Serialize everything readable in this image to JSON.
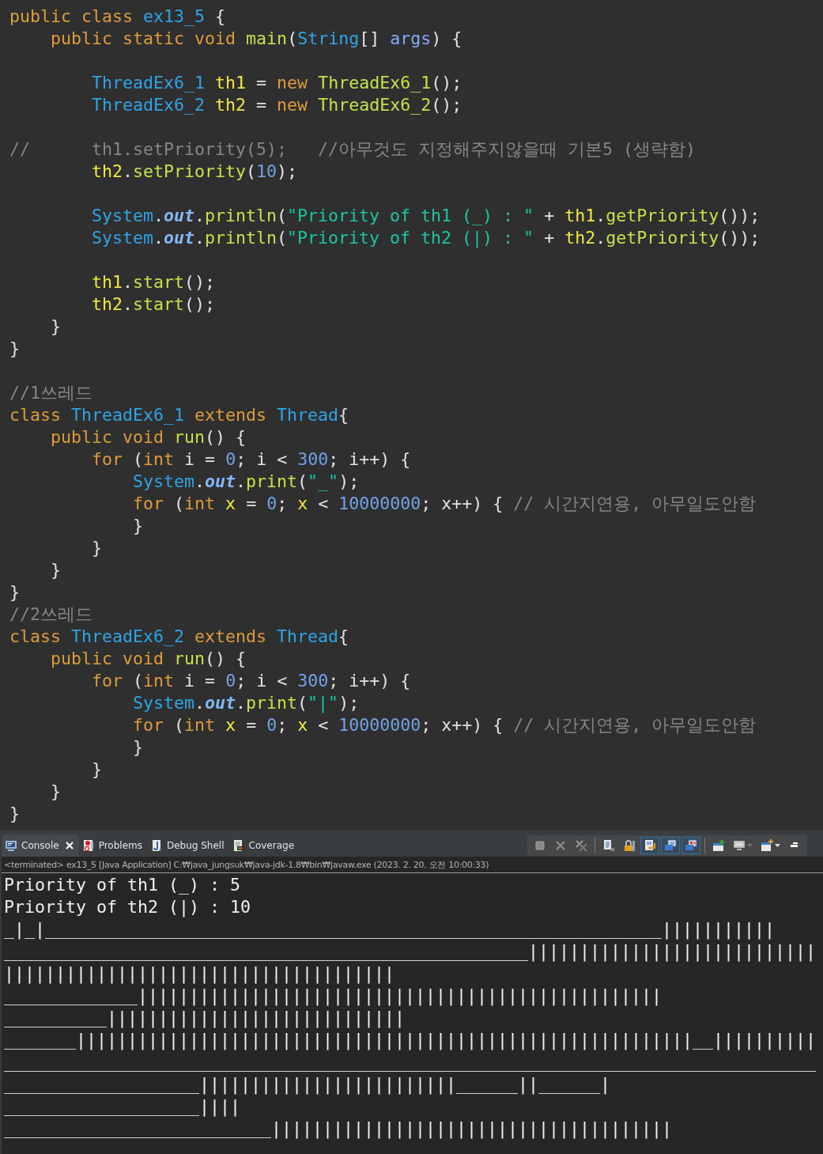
{
  "editor": {
    "lines": [
      {
        "kind": "code",
        "tokens": [
          {
            "kind": "keyword",
            "text": "public"
          },
          {
            "kind": "keyword",
            "text": " class"
          },
          {
            "kind": "type",
            "text": " ex13_5"
          },
          {
            "kind": "plain",
            "text": " {"
          }
        ]
      },
      {
        "kind": "code",
        "tokens": [
          {
            "kind": "keyword",
            "text": "    public"
          },
          {
            "kind": "keyword",
            "text": " static"
          },
          {
            "kind": "keyword",
            "text": " void"
          },
          {
            "kind": "method",
            "text": " main"
          },
          {
            "kind": "plain",
            "text": "("
          },
          {
            "kind": "type",
            "text": "String"
          },
          {
            "kind": "plain",
            "text": "[]"
          },
          {
            "kind": "parameter",
            "text": " args"
          },
          {
            "kind": "plain",
            "text": ") {"
          }
        ]
      },
      {
        "kind": "blank"
      },
      {
        "kind": "code",
        "tokens": [
          {
            "kind": "type",
            "text": "        ThreadEx6_1"
          },
          {
            "kind": "variable",
            "text": " th1"
          },
          {
            "kind": "plain",
            "text": " ="
          },
          {
            "kind": "keyword",
            "text": " new"
          },
          {
            "kind": "method",
            "text": " ThreadEx6_1"
          },
          {
            "kind": "plain",
            "text": "();"
          }
        ]
      },
      {
        "kind": "code",
        "tokens": [
          {
            "kind": "type",
            "text": "        ThreadEx6_2"
          },
          {
            "kind": "variable",
            "text": " th2"
          },
          {
            "kind": "plain",
            "text": " ="
          },
          {
            "kind": "keyword",
            "text": " new"
          },
          {
            "kind": "method",
            "text": " ThreadEx6_2"
          },
          {
            "kind": "plain",
            "text": "();"
          }
        ]
      },
      {
        "kind": "blank"
      },
      {
        "kind": "code",
        "tokens": [
          {
            "kind": "comment",
            "text": "//      th1.setPriority(5);   //아무것도 지정해주지않을때 기본5 (생략함)"
          }
        ]
      },
      {
        "kind": "code",
        "tokens": [
          {
            "kind": "variable",
            "text": "        th2"
          },
          {
            "kind": "plain",
            "text": "."
          },
          {
            "kind": "method",
            "text": "setPriority"
          },
          {
            "kind": "plain",
            "text": "("
          },
          {
            "kind": "number",
            "text": "10"
          },
          {
            "kind": "plain",
            "text": ");"
          }
        ]
      },
      {
        "kind": "blank"
      },
      {
        "kind": "code",
        "tokens": [
          {
            "kind": "type",
            "text": "        System"
          },
          {
            "kind": "plain",
            "text": "."
          },
          {
            "kind": "field",
            "text": "out"
          },
          {
            "kind": "plain",
            "text": "."
          },
          {
            "kind": "method",
            "text": "println"
          },
          {
            "kind": "plain",
            "text": "("
          },
          {
            "kind": "string",
            "text": "\"Priority of th1 (_) : \""
          },
          {
            "kind": "plain",
            "text": " +"
          },
          {
            "kind": "variable",
            "text": " th1"
          },
          {
            "kind": "plain",
            "text": "."
          },
          {
            "kind": "method",
            "text": "getPriority"
          },
          {
            "kind": "plain",
            "text": "());"
          }
        ]
      },
      {
        "kind": "code",
        "tokens": [
          {
            "kind": "type",
            "text": "        System"
          },
          {
            "kind": "plain",
            "text": "."
          },
          {
            "kind": "field",
            "text": "out"
          },
          {
            "kind": "plain",
            "text": "."
          },
          {
            "kind": "method",
            "text": "println"
          },
          {
            "kind": "plain",
            "text": "("
          },
          {
            "kind": "string",
            "text": "\"Priority of th2 (|) : \""
          },
          {
            "kind": "plain",
            "text": " +"
          },
          {
            "kind": "variable",
            "text": " th2"
          },
          {
            "kind": "plain",
            "text": "."
          },
          {
            "kind": "method",
            "text": "getPriority"
          },
          {
            "kind": "plain",
            "text": "());"
          }
        ]
      },
      {
        "kind": "blank"
      },
      {
        "kind": "code",
        "tokens": [
          {
            "kind": "variable",
            "text": "        th1"
          },
          {
            "kind": "plain",
            "text": "."
          },
          {
            "kind": "method",
            "text": "start"
          },
          {
            "kind": "plain",
            "text": "();"
          }
        ]
      },
      {
        "kind": "code",
        "tokens": [
          {
            "kind": "variable",
            "text": "        th2"
          },
          {
            "kind": "plain",
            "text": "."
          },
          {
            "kind": "method",
            "text": "start"
          },
          {
            "kind": "plain",
            "text": "();"
          }
        ]
      },
      {
        "kind": "code",
        "tokens": [
          {
            "kind": "plain",
            "text": "    }"
          }
        ]
      },
      {
        "kind": "code",
        "tokens": [
          {
            "kind": "plain",
            "text": "}"
          }
        ]
      },
      {
        "kind": "blank"
      },
      {
        "kind": "code",
        "tokens": [
          {
            "kind": "comment",
            "text": "//1쓰레드"
          }
        ]
      },
      {
        "kind": "code",
        "tokens": [
          {
            "kind": "keyword",
            "text": "class"
          },
          {
            "kind": "type",
            "text": " ThreadEx6_1"
          },
          {
            "kind": "keyword",
            "text": " extends"
          },
          {
            "kind": "type",
            "text": " Thread"
          },
          {
            "kind": "plain",
            "text": "{"
          }
        ]
      },
      {
        "kind": "code",
        "tokens": [
          {
            "kind": "keyword",
            "text": "    public"
          },
          {
            "kind": "keyword",
            "text": " void"
          },
          {
            "kind": "method",
            "text": " run"
          },
          {
            "kind": "plain",
            "text": "() {"
          }
        ]
      },
      {
        "kind": "code",
        "tokens": [
          {
            "kind": "keyword",
            "text": "        for"
          },
          {
            "kind": "plain",
            "text": " ("
          },
          {
            "kind": "keyword",
            "text": "int"
          },
          {
            "kind": "plain",
            "text": " i ="
          },
          {
            "kind": "number",
            "text": " 0"
          },
          {
            "kind": "plain",
            "text": "; i <"
          },
          {
            "kind": "number",
            "text": " 300"
          },
          {
            "kind": "plain",
            "text": "; i++) {"
          }
        ]
      },
      {
        "kind": "code",
        "tokens": [
          {
            "kind": "type",
            "text": "            System"
          },
          {
            "kind": "plain",
            "text": "."
          },
          {
            "kind": "field",
            "text": "out"
          },
          {
            "kind": "plain",
            "text": "."
          },
          {
            "kind": "method",
            "text": "print"
          },
          {
            "kind": "plain",
            "text": "("
          },
          {
            "kind": "string",
            "text": "\"_\""
          },
          {
            "kind": "plain",
            "text": ");"
          }
        ]
      },
      {
        "kind": "code",
        "tokens": [
          {
            "kind": "keyword",
            "text": "            for"
          },
          {
            "kind": "plain",
            "text": " ("
          },
          {
            "kind": "keyword",
            "text": "int"
          },
          {
            "kind": "variable",
            "text": " x"
          },
          {
            "kind": "plain",
            "text": " ="
          },
          {
            "kind": "number",
            "text": " 0"
          },
          {
            "kind": "plain",
            "text": ";"
          },
          {
            "kind": "variable",
            "text": " x"
          },
          {
            "kind": "plain",
            "text": " <"
          },
          {
            "kind": "number",
            "text": " 10000000"
          },
          {
            "kind": "plain",
            "text": "; x++) {"
          },
          {
            "kind": "comment",
            "text": " // 시간지연용, 아무일도안함"
          }
        ]
      },
      {
        "kind": "code",
        "tokens": [
          {
            "kind": "plain",
            "text": "            }"
          }
        ]
      },
      {
        "kind": "code",
        "tokens": [
          {
            "kind": "plain",
            "text": "        }"
          }
        ]
      },
      {
        "kind": "code",
        "tokens": [
          {
            "kind": "plain",
            "text": "    }"
          }
        ]
      },
      {
        "kind": "code",
        "tokens": [
          {
            "kind": "plain",
            "text": "}"
          }
        ]
      },
      {
        "kind": "code",
        "tokens": [
          {
            "kind": "comment",
            "text": "//2쓰레드"
          }
        ]
      },
      {
        "kind": "code",
        "tokens": [
          {
            "kind": "keyword",
            "text": "class"
          },
          {
            "kind": "type",
            "text": " ThreadEx6_2"
          },
          {
            "kind": "keyword",
            "text": " extends"
          },
          {
            "kind": "type",
            "text": " Thread"
          },
          {
            "kind": "plain",
            "text": "{"
          }
        ]
      },
      {
        "kind": "code",
        "tokens": [
          {
            "kind": "keyword",
            "text": "    public"
          },
          {
            "kind": "keyword",
            "text": " void"
          },
          {
            "kind": "method",
            "text": " run"
          },
          {
            "kind": "plain",
            "text": "() {"
          }
        ]
      },
      {
        "kind": "code",
        "tokens": [
          {
            "kind": "keyword",
            "text": "        for"
          },
          {
            "kind": "plain",
            "text": " ("
          },
          {
            "kind": "keyword",
            "text": "int"
          },
          {
            "kind": "plain",
            "text": " i ="
          },
          {
            "kind": "number",
            "text": " 0"
          },
          {
            "kind": "plain",
            "text": "; i <"
          },
          {
            "kind": "number",
            "text": " 300"
          },
          {
            "kind": "plain",
            "text": "; i++) {"
          }
        ]
      },
      {
        "kind": "code",
        "tokens": [
          {
            "kind": "type",
            "text": "            System"
          },
          {
            "kind": "plain",
            "text": "."
          },
          {
            "kind": "field",
            "text": "out"
          },
          {
            "kind": "plain",
            "text": "."
          },
          {
            "kind": "method",
            "text": "print"
          },
          {
            "kind": "plain",
            "text": "("
          },
          {
            "kind": "string",
            "text": "\"|\""
          },
          {
            "kind": "plain",
            "text": ");"
          }
        ]
      },
      {
        "kind": "code",
        "tokens": [
          {
            "kind": "keyword",
            "text": "            for"
          },
          {
            "kind": "plain",
            "text": " ("
          },
          {
            "kind": "keyword",
            "text": "int"
          },
          {
            "kind": "variable",
            "text": " x"
          },
          {
            "kind": "plain",
            "text": " ="
          },
          {
            "kind": "number",
            "text": " 0"
          },
          {
            "kind": "plain",
            "text": ";"
          },
          {
            "kind": "variable",
            "text": " x"
          },
          {
            "kind": "plain",
            "text": " <"
          },
          {
            "kind": "number",
            "text": " 10000000"
          },
          {
            "kind": "plain",
            "text": "; x++) {"
          },
          {
            "kind": "comment",
            "text": " // 시간지연용, 아무일도안함"
          }
        ]
      },
      {
        "kind": "code",
        "tokens": [
          {
            "kind": "plain",
            "text": "            }"
          }
        ]
      },
      {
        "kind": "code",
        "tokens": [
          {
            "kind": "plain",
            "text": "        }"
          }
        ]
      },
      {
        "kind": "code",
        "tokens": [
          {
            "kind": "plain",
            "text": "    }"
          }
        ]
      },
      {
        "kind": "code",
        "tokens": [
          {
            "kind": "plain",
            "text": "}"
          }
        ]
      }
    ]
  },
  "console": {
    "tabs": [
      {
        "kind": "console",
        "label": "Console",
        "selected": true,
        "closable": true
      },
      {
        "kind": "problems",
        "label": "Problems",
        "selected": false,
        "closable": false
      },
      {
        "kind": "debug-shell",
        "label": "Debug Shell",
        "selected": false,
        "closable": false
      },
      {
        "kind": "coverage",
        "label": "Coverage",
        "selected": false,
        "closable": false
      }
    ],
    "toolbar_groups": [
      [
        {
          "kind": "terminate",
          "selected": false
        },
        {
          "kind": "remove",
          "selected": false
        },
        {
          "kind": "remove-all",
          "selected": false
        }
      ],
      [
        {
          "kind": "clear",
          "selected": false
        },
        {
          "kind": "scroll-lock",
          "selected": false
        },
        {
          "kind": "word-wrap",
          "selected": true
        },
        {
          "kind": "stdout",
          "selected": true
        },
        {
          "kind": "stderr",
          "selected": true
        }
      ],
      [
        {
          "kind": "pin",
          "selected": false
        },
        {
          "kind": "display",
          "selected": false
        },
        {
          "kind": "open",
          "selected": false
        }
      ]
    ],
    "status": "<terminated> ex13_5 [Java Application] C:₩java_jungsuk₩java-jdk-1.8₩bin₩javaw.exe (2023. 2. 20. 오전 10:00:33)",
    "output_lines": [
      "Priority of th1 (_) : 5",
      "Priority of th2 (|) : 10",
      "_|_|____________________________________________________________|||||||||||",
      "___________________________________________________||||||||||||||||||||||||||||",
      "||||||||||||||||||||||||||||||||||||||",
      "_____________|||||||||||||||||||||||||||||||||||||||||||||||||||",
      "__________|||||||||||||||||||||||||||||",
      "_______||||||||||||||||||||||||||||||||||||||||||||||||||||||||||||__||||||||||",
      "_______________________________________________________________________________",
      "___________________|||||||||||||||||||||||||______||______|",
      "___________________||||",
      "__________________________|||||||||||||||||||||||||||||||||||||||"
    ]
  }
}
